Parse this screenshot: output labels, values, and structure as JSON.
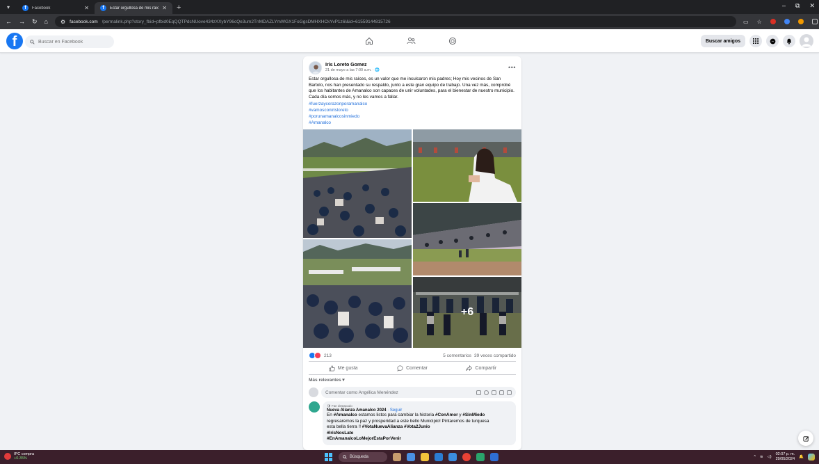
{
  "browser": {
    "tabs": [
      {
        "title": "Facebook",
        "active": false
      },
      {
        "title": "Estar orgullosa de mis raíces, es...",
        "active": true
      }
    ],
    "url_host": "facebook.com",
    "url_path": "/permalink.php?story_fbid=pfbid0EqQQTPdcNUove434zXXybY96cQe3um2TnMDAZLYmWGX1FoGgsDMHXHCkYvP1z6l&id=61559144815726"
  },
  "facebook": {
    "search_placeholder": "Buscar en Facebook",
    "find_friends": "Buscar amigos"
  },
  "post": {
    "author": "Iris Loreto Gomez",
    "meta": "21 de mayo a las 7:00 a.m. · 🌐",
    "text": "Estar orgullosa de mis raíces, es un valor que me inculcaron mis padres; Hoy mis vecinos de San Bartolo, nos han presentado su respaldo, junto a este gran equipo de trabajo. Una vez más, comprobé que los habitantes de Amanalco son capaces de unir voluntades, para el bienestar de nuestro municipio. Cada día somos más, y no les vamos a fallar.",
    "hashtags": [
      "#fuerzaycorazonporamanalco",
      "#vamosconirisloreto",
      "#porunamanalcosinmiedo",
      "#Amanalco"
    ],
    "more_photos": "+6",
    "reaction_count": "213",
    "comments_count": "5 comentarios",
    "shares_count": "39 veces compartido",
    "actions": {
      "like": "Me gusta",
      "comment": "Comentar",
      "share": "Compartir"
    },
    "relevance": "Más relevantes ▾",
    "comment_placeholder": "Comentar como Angélica Menéndez"
  },
  "comment": {
    "badge": "🛡 Fan destacado",
    "author": "Nueva Alianza Amanalco 2024",
    "follow": "· Seguir",
    "line1_a": "En ",
    "line1_b": "#Amanalco",
    "line1_c": " estamos listos para cambiar la historia ",
    "line1_d": "#ConAmor",
    "line1_e": " y ",
    "line1_f": "#SinMiedo",
    "line2": "regresaremos la paz y prosperidad a este bello Municipio! Pintaremos de turquesa",
    "line3_a": "esta bella tierra !! ",
    "line3_b": "#VotaNuevaAlianza #Vota2Junio",
    "line4": "#IrisNosLate",
    "line5": "#EnAmanalcoLoMejorEstaPorVenir"
  },
  "taskbar": {
    "widget_title": "IPC compra",
    "widget_value": "+0.35%",
    "search": "Búsqueda",
    "time": "02:07 p. m.",
    "date": "29/05/2024"
  },
  "colors": {
    "fb_blue": "#1877f2",
    "link_blue": "#216fdb",
    "chrome_dark": "#202124",
    "taskbar": "#3b1f2b"
  }
}
